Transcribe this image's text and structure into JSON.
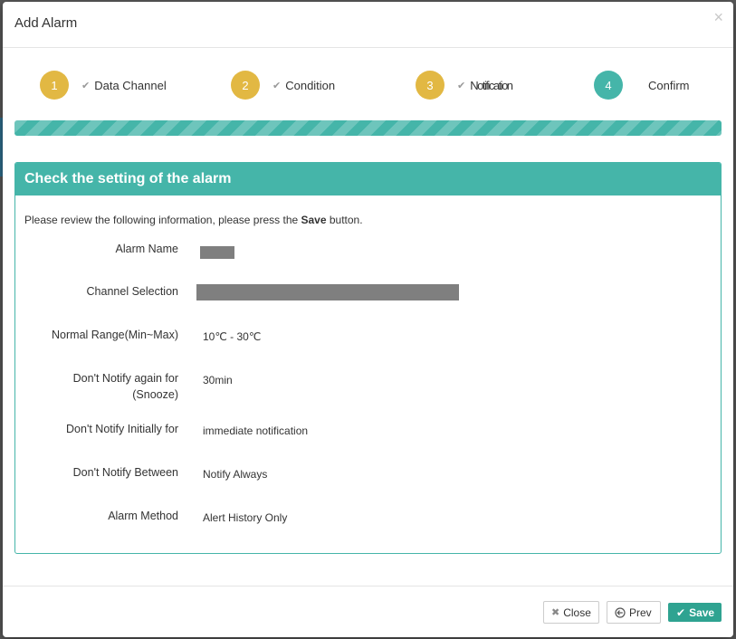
{
  "modal": {
    "title": "Add Alarm",
    "close_glyph": "×"
  },
  "steps": [
    {
      "number": "1",
      "label": "Data Channel",
      "status": "done"
    },
    {
      "number": "2",
      "label": "Condition",
      "status": "done"
    },
    {
      "number": "3",
      "label": "Notification",
      "status": "done"
    },
    {
      "number": "4",
      "label": "Confirm",
      "status": "active"
    }
  ],
  "progress": {
    "value": 1.0
  },
  "panel": {
    "heading": "Check the setting of the alarm",
    "intro_before": "Please review the following information, please press the ",
    "intro_bold": "Save",
    "intro_after": " button.",
    "fields": {
      "alarm_name": {
        "label": "Alarm Name",
        "value": ""
      },
      "channel_selection": {
        "label": "Channel Selection",
        "value": ""
      },
      "normal_range": {
        "label": "Normal Range(Min~Max)",
        "value": "10℃ - 30℃"
      },
      "snooze": {
        "label_line1": "Don't Notify again for",
        "label_line2": "(Snooze)",
        "value": "30min"
      },
      "notify_initially": {
        "label": "Don't Notify Initially for",
        "value": "immediate notification"
      },
      "notify_between": {
        "label": "Don't Notify Between",
        "value": "Notify Always"
      },
      "alarm_method": {
        "label": "Alarm Method",
        "value": "Alert History Only"
      }
    }
  },
  "footer": {
    "close_label": "Close",
    "prev_label": "Prev",
    "save_label": "Save"
  },
  "colors": {
    "teal": "#45b5a9",
    "step_done": "#e2b843",
    "save_button": "#2fa391"
  },
  "icons": {
    "check": "check-icon",
    "close": "times-icon",
    "prev": "circle-arrow-left-icon",
    "save": "check-icon"
  }
}
